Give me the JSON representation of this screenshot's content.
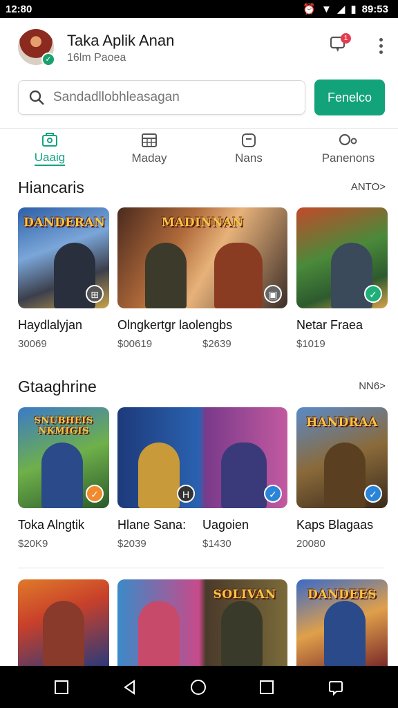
{
  "status_bar": {
    "time": "12:80",
    "clock": "89:53",
    "icons": [
      "alarm-icon",
      "wifi-icon",
      "signal-icon",
      "battery-icon"
    ]
  },
  "header": {
    "title": "Taka Aplik Anan",
    "subtitle": "16lm Paoea",
    "notification_count": "1"
  },
  "search": {
    "placeholder": "Sandadllobhleasagan",
    "button_label": "Fenelco"
  },
  "tabs": [
    {
      "label": "Uaaig",
      "icon": "store-icon",
      "active": true
    },
    {
      "label": "Maday",
      "icon": "calendar-icon",
      "active": false
    },
    {
      "label": "Nans",
      "icon": "tag-icon",
      "active": false
    },
    {
      "label": "Panenons",
      "icon": "profile-icon",
      "active": false
    }
  ],
  "sections": [
    {
      "title": "Hiancaris",
      "more": "ANTO>",
      "items": [
        {
          "name": "Haydlalyjan",
          "price": "30069",
          "art_title": "DANDERAN",
          "badge_color": "#555555"
        },
        {
          "name": "Olngkertgr laolengbs",
          "price": "$00619",
          "price2": "$2639",
          "art_title": "MADINNAN",
          "badge_color": "#666666"
        },
        {
          "name": "Netar Fraea",
          "price": "$1019",
          "art_title": "",
          "badge_color": "#1fb07a"
        }
      ]
    },
    {
      "title": "Gtaaghrine",
      "more": "NN6>",
      "items": [
        {
          "name": "Toka Alngtik",
          "price": "$20K9",
          "art_title": "SNUBHEIS NKMIGIS",
          "badge_color": "#f08a2c"
        },
        {
          "name": "Hlane Sana:",
          "price": "$2039",
          "name2": "Uagoien",
          "price2": "$1430",
          "art_title": "",
          "badge_color": "#333333"
        },
        {
          "name": "Kaps Blagaas",
          "price": "20080",
          "art_title": "HANDRAA",
          "badge_color": "#2a84d8"
        }
      ]
    },
    {
      "title": "",
      "more": "",
      "items": [
        {
          "name": "",
          "price": "",
          "art_title": "",
          "badge_color": "#444444"
        },
        {
          "name": "",
          "price": "",
          "art_title": "SOLIVAN",
          "badge_color": "#2a84d8"
        },
        {
          "name": "",
          "price": "",
          "art_title": "DANDEES",
          "badge_color": "#2a84d8"
        }
      ]
    }
  ],
  "colors": {
    "accent": "#12a37a",
    "notification": "#e53b4f"
  }
}
